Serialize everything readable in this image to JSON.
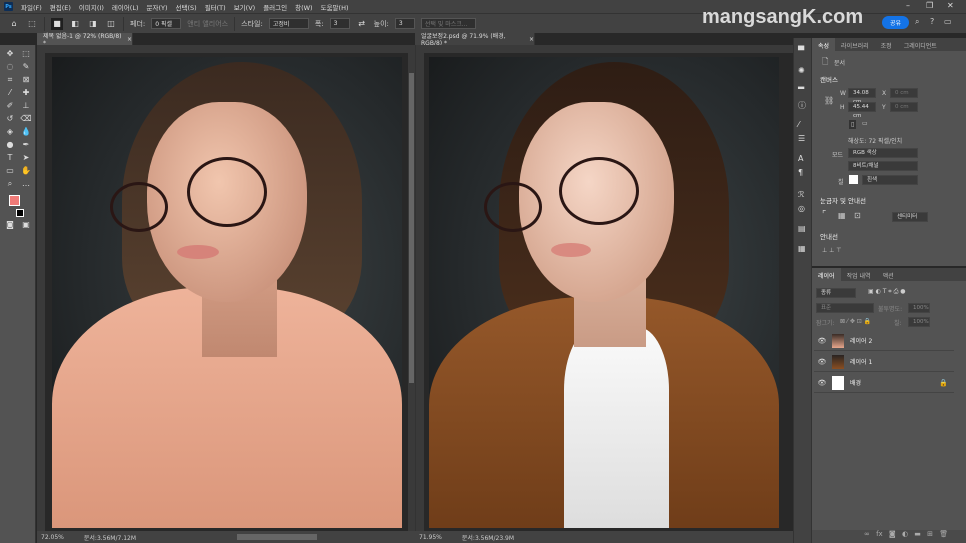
{
  "menubar": {
    "app_icon": "Ps",
    "items": [
      "파일(F)",
      "편집(E)",
      "이미지(I)",
      "레이어(L)",
      "문자(Y)",
      "선택(S)",
      "필터(T)",
      "보기(V)",
      "플러그인",
      "창(W)",
      "도움말(H)"
    ]
  },
  "options": {
    "feather_label": "페더:",
    "feather_value": "0 픽셀",
    "antialias_label": "앤티 앨리어스",
    "style_label": "스타일:",
    "style_value": "고정비",
    "width_label": "폭:",
    "width_value": "3",
    "height_label": "높이:",
    "height_value": "3",
    "select_mask": "선택 및 마스크..."
  },
  "watermark": "mangsangK.com",
  "share_label": "공유",
  "documents": [
    {
      "tab": "제목 없음-1 @ 72% (RGB/8) *",
      "zoom": "72.05%",
      "doc_info": "문서:3.56M/7.12M",
      "shirt_color": "#e9a88d"
    },
    {
      "tab": "얼굴보정2.psd @ 71.9% (배경, RGB/8) *",
      "zoom": "71.95%",
      "doc_info": "문서:3.56M/23.9M",
      "shirt_color": "#8a4f22"
    }
  ],
  "properties": {
    "tabs": [
      "속성",
      "라이브러리",
      "조정",
      "그레이디언트"
    ],
    "doc_label": "문서",
    "canvas_title": "캔버스",
    "w_label": "W",
    "w_value": "34.08 cm",
    "h_label": "H",
    "h_value": "45.44 cm",
    "x_label": "X",
    "x_value": "0 cm",
    "y_label": "Y",
    "y_value": "0 cm",
    "resolution": "해상도: 72 픽셀/인치",
    "mode_label": "모드",
    "mode_value": "RGB 색상",
    "bits_value": "8비트/채널",
    "fill_label": "칠",
    "fill_value": "흰색",
    "rulers_title": "눈금자 및 안내선",
    "units_value": "센티미터",
    "guides_title": "안내선"
  },
  "layers": {
    "tabs": [
      "레이어",
      "작업 내역",
      "액션"
    ],
    "filter_value": "종류",
    "blend_value": "표준",
    "opacity_label": "불투명도:",
    "opacity_value": "100%",
    "lock_label": "잠그기:",
    "fill_label": "칠:",
    "fill_value": "100%",
    "items": [
      {
        "name": "레이어 2"
      },
      {
        "name": "레이어 1"
      },
      {
        "name": "배경",
        "locked": true
      }
    ]
  },
  "colors": {
    "foreground": "#f07b78",
    "background": "#000000",
    "accent": "#1473e6"
  }
}
